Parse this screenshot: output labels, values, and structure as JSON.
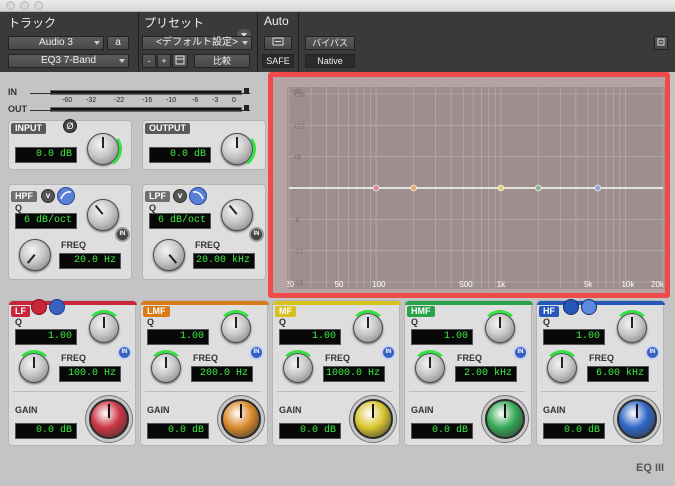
{
  "header": {
    "track_label": "トラック",
    "preset_label": "プリセット",
    "auto_label": "Auto",
    "track_name": "Audio 3",
    "track_slot": "a",
    "insert_name": "EQ3 7-Band",
    "preset_name": "<デフォルト設定>",
    "minus": "-",
    "plus": "+",
    "compare": "比較",
    "bypass": "バイパス",
    "safe": "SAFE",
    "native": "Native"
  },
  "meters": {
    "in_label": "IN",
    "out_label": "OUT",
    "scale": [
      "-60",
      "-32",
      "-22",
      "-16",
      "-10",
      "-6",
      "-3",
      "0"
    ]
  },
  "input": {
    "label": "INPUT",
    "value": "0.0 dB"
  },
  "output": {
    "label": "OUTPUT",
    "value": "0.0 dB"
  },
  "hpf": {
    "label": "HPF",
    "q_label": "Q",
    "q_value": "6 dB/oct",
    "freq_label": "FREQ",
    "freq_value": "20.0 Hz",
    "in_label": "IN"
  },
  "lpf": {
    "label": "LPF",
    "q_label": "Q",
    "q_value": "6 dB/oct",
    "freq_label": "FREQ",
    "freq_value": "20.00 kHz",
    "in_label": "IN"
  },
  "bands": [
    {
      "label": "LF",
      "color": "#c8253a",
      "knob_color": "#cc3545",
      "q_label": "Q",
      "q": "1.00",
      "freq_label": "FREQ",
      "freq": "100.0 Hz",
      "gain_label": "GAIN",
      "gain": "0.0 dB",
      "in_label": "IN"
    },
    {
      "label": "LMF",
      "color": "#d87a15",
      "knob_color": "#d98a2a",
      "q_label": "Q",
      "q": "1.00",
      "freq_label": "FREQ",
      "freq": "200.0 Hz",
      "gain_label": "GAIN",
      "gain": "0.0 dB",
      "in_label": "IN"
    },
    {
      "label": "MF",
      "color": "#d8c020",
      "knob_color": "#d8c530",
      "q_label": "Q",
      "q": "1.00",
      "freq_label": "FREQ",
      "freq": "1000.0 Hz",
      "gain_label": "GAIN",
      "gain": "0.0 dB",
      "in_label": "IN"
    },
    {
      "label": "HMF",
      "color": "#2aa24a",
      "knob_color": "#35a855",
      "q_label": "Q",
      "q": "1.00",
      "freq_label": "FREQ",
      "freq": "2.00 kHz",
      "gain_label": "GAIN",
      "gain": "0.0 dB",
      "in_label": "IN"
    },
    {
      "label": "HF",
      "color": "#2656b8",
      "knob_color": "#2f66c4",
      "q_label": "Q",
      "q": "1.00",
      "freq_label": "FREQ",
      "freq": "6.00 kHz",
      "gain_label": "GAIN",
      "gain": "0.0 dB",
      "in_label": "IN"
    }
  ],
  "graph": {
    "y_labels": [
      "dB",
      "+18",
      "+12",
      "+6",
      "0",
      "-6",
      "-12",
      "-18"
    ],
    "x_labels": [
      "20",
      "50",
      "100",
      "500",
      "1k",
      "5k",
      "10k",
      "20k"
    ],
    "y_values": [
      18,
      12,
      6,
      0,
      -6,
      -12,
      -18
    ],
    "x_values": [
      20,
      50,
      100,
      500,
      1000,
      5000,
      10000,
      20000
    ],
    "band_points_hz": [
      100,
      200,
      1000,
      2000,
      6000
    ],
    "point_colors": [
      "#d88a9a",
      "#e0b070",
      "#e0d070",
      "#88b888",
      "#9aa0d8"
    ]
  },
  "footer": {
    "logo": "EQ III"
  }
}
